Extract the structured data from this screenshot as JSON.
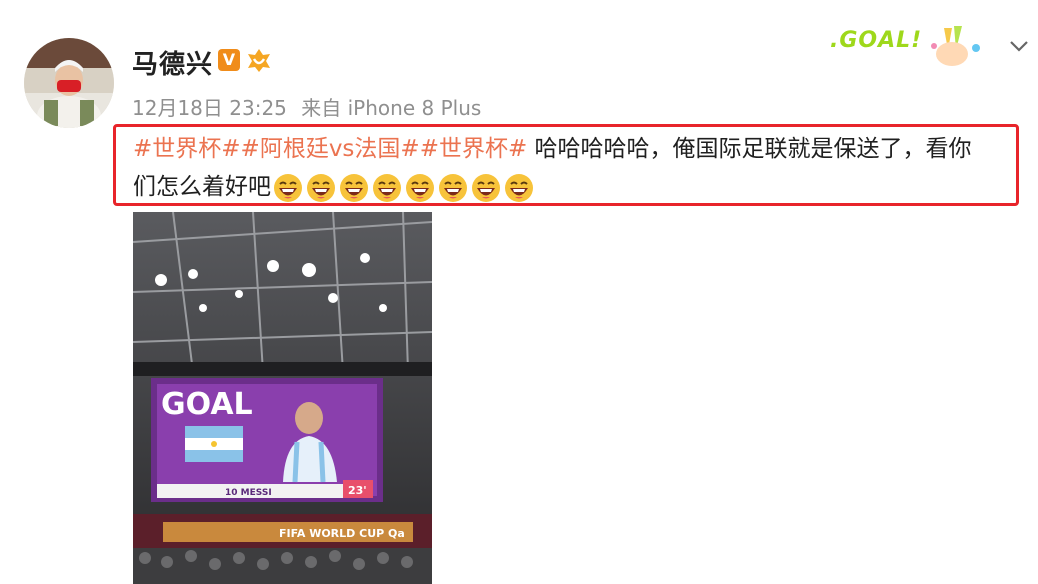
{
  "post": {
    "author": "马德兴",
    "vip_badge": "V",
    "date": "12月18日 23:25",
    "source": "来自 iPhone 8 Plus",
    "topics": [
      "#世界杯#",
      "#阿根廷vs法国#",
      "#世界杯#"
    ],
    "text_part1": " 哈哈哈哈哈，俺国际足联就是保送了，看你",
    "text_part2": "们怎么着好吧",
    "emoji_count": 8,
    "emoji_name": "laughing-face-icon",
    "highlight_color": "#e8242a",
    "topic_color": "#eb7350"
  },
  "decor": {
    "goal_badge": ".GOAL!"
  },
  "photo": {
    "screen_heading": "GOAL",
    "player_caption": "10 MESSI",
    "minute": "23'",
    "banner_text": "FIFA WORLD CUP Qa"
  }
}
